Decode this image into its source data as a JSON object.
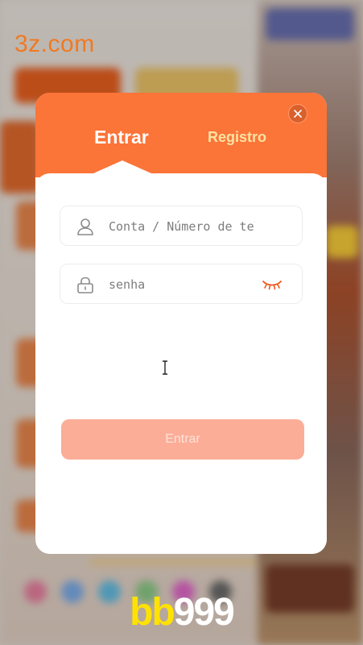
{
  "watermark": {
    "site": "3z.com"
  },
  "brand": {
    "part1": "bb",
    "part2": "999"
  },
  "login_modal": {
    "tabs": {
      "login": "Entrar",
      "register": "Registro"
    },
    "account_field": {
      "placeholder": "Conta / Número de telefone",
      "value": ""
    },
    "password_field": {
      "placeholder": "senha",
      "value": ""
    },
    "submit_label": "Entrar",
    "icons": {
      "close": "close-icon",
      "account": "user-icon",
      "password": "lock-icon",
      "visibility": "eye-closed-icon"
    }
  },
  "colors": {
    "accent": "#fb7438",
    "register_tab": "#ffe3a3",
    "submit_disabled": "#fbad97",
    "eye_icon": "#f05a22",
    "brand_yellow": "#ffe200"
  }
}
